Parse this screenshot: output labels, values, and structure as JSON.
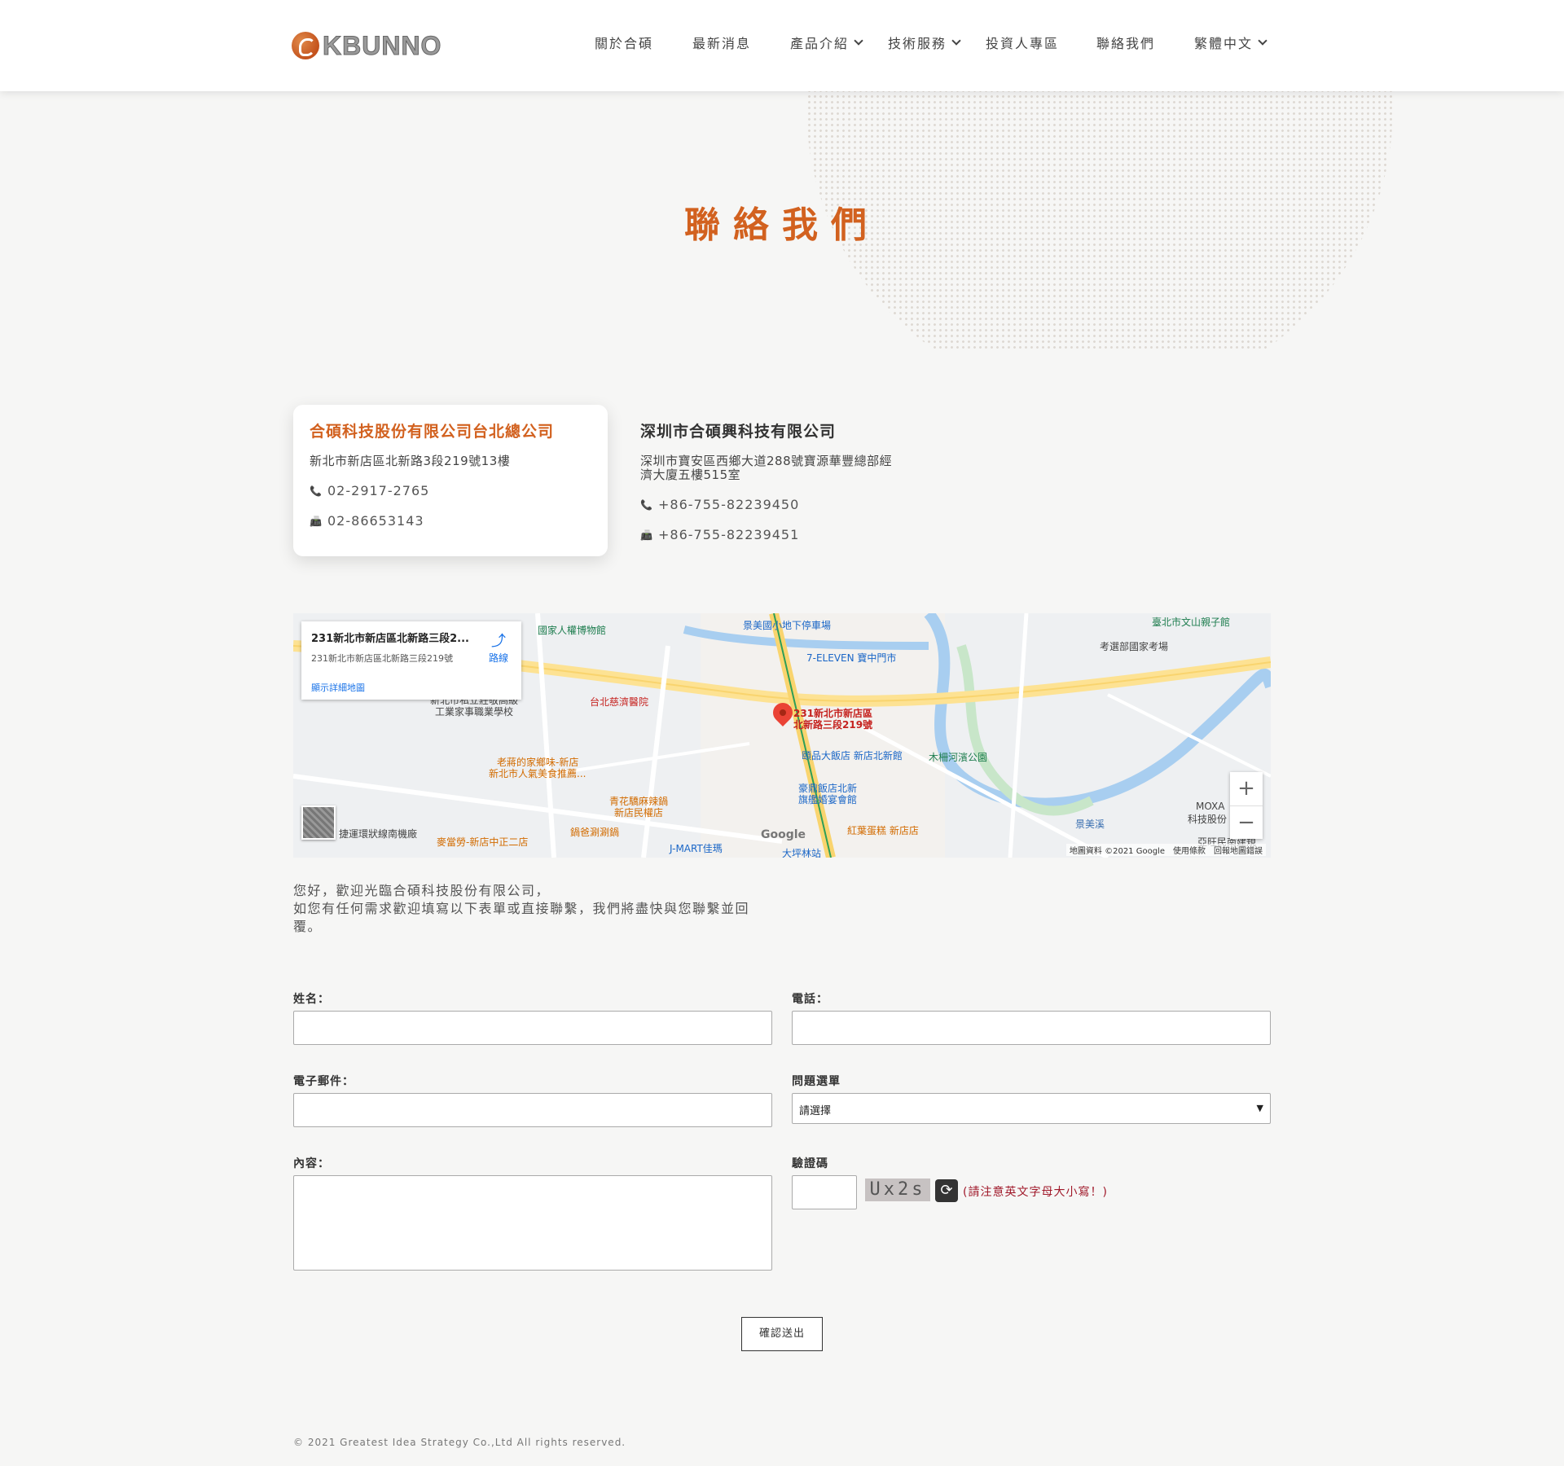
{
  "header": {
    "logo_text": "KBUNNO",
    "nav": [
      {
        "label": "關於合碩",
        "dropdown": false
      },
      {
        "label": "最新消息",
        "dropdown": false
      },
      {
        "label": "產品介紹",
        "dropdown": true
      },
      {
        "label": "技術服務",
        "dropdown": true
      },
      {
        "label": "投資人專區",
        "dropdown": false
      },
      {
        "label": "聯絡我們",
        "dropdown": false
      },
      {
        "label": "繁體中文",
        "dropdown": true
      }
    ]
  },
  "hero": {
    "title": "聯絡我們"
  },
  "offices": [
    {
      "name": "合碩科技股份有限公司台北總公司",
      "address": "新北市新店區北新路3段219號13樓",
      "phone": "02-2917-2765",
      "fax": "02-86653143"
    },
    {
      "name": "深圳市合碩興科技有限公司",
      "address_line1": "深圳市寶安區西鄉大道288號寶源華豐總部經",
      "address_line2": "濟大廈五樓515室",
      "phone": "+86-755-82239450",
      "fax": "+86-755-82239451"
    }
  ],
  "map": {
    "info_title": "231新北市新店區北新路三段2...",
    "info_address": "231新北市新店區北新路三段219號",
    "route_label": "路線",
    "detail_link": "顯示詳細地圖",
    "pin_label_1": "231新北市新店區",
    "pin_label_2": "北新路三段219號",
    "google_logo": "Google",
    "credit": "地圖資料 ©2021 Google　使用條款　回報地圖錯誤",
    "zoom_in": "+",
    "zoom_out": "−",
    "labels": [
      {
        "text": "國家人權博物館",
        "color": "#1e7d4f"
      },
      {
        "text": "景美國小地下停車場",
        "color": "#1a66c7"
      },
      {
        "text": "臺北市文山親子館",
        "color": "#1e7d4f"
      },
      {
        "text": "考選部國家考場",
        "color": "#444"
      },
      {
        "text": "7-ELEVEN 寶中門市",
        "color": "#1a66c7"
      },
      {
        "text": "台北慈濟醫院",
        "color": "#c5221f"
      },
      {
        "text": "新北市私立莊敬高級",
        "color": "#444"
      },
      {
        "text": "工業家事職業學校",
        "color": "#444"
      },
      {
        "text": "頤品大飯店 新店北新館",
        "color": "#1a66c7"
      },
      {
        "text": "木柵河濱公園",
        "color": "#1e7d4f"
      },
      {
        "text": "老蔣的家鄉味-新店",
        "color": "#d26b00"
      },
      {
        "text": "新北市人氣美食推薦...",
        "color": "#d26b00"
      },
      {
        "text": "豪鼎飯店北新",
        "color": "#1a66c7"
      },
      {
        "text": "旗艦婚宴會館",
        "color": "#1a66c7"
      },
      {
        "text": "青花驕麻辣鍋",
        "color": "#d26b00"
      },
      {
        "text": "新店民權店",
        "color": "#d26b00"
      },
      {
        "text": "鍋爸涮涮鍋",
        "color": "#d26b00"
      },
      {
        "text": "紅葉蛋糕 新店店",
        "color": "#d26b00"
      },
      {
        "text": "麥當勞-新店中正二店",
        "color": "#d26b00"
      },
      {
        "text": "J-MART佳瑪",
        "color": "#1a66c7"
      },
      {
        "text": "大坪林站",
        "color": "#1a66c7"
      },
      {
        "text": "捷運環狀線南機廠",
        "color": "#444"
      },
      {
        "text": "MOXA",
        "color": "#444"
      },
      {
        "text": "科技股份",
        "color": "#444"
      },
      {
        "text": "景美溪",
        "color": "#3a6fb0"
      },
      {
        "text": "亞旺民南建規",
        "color": "#444"
      }
    ]
  },
  "intro": {
    "line1": "您好，歡迎光臨合碩科技股份有限公司，",
    "line2": "如您有任何需求歡迎填寫以下表單或直接聯繫，我們將盡快與您聯繫並回",
    "line3": "覆。"
  },
  "form": {
    "name_label": "姓名：",
    "phone_label": "電話：",
    "email_label": "電子郵件：",
    "topic_label": "問題選單",
    "topic_selected": "請選擇",
    "content_label": "內容：",
    "captcha_label": "驗證碼",
    "captcha_text": "Ux2s",
    "captcha_note": "(請注意英文字母大小寫！)",
    "submit_label": "確認送出"
  },
  "footer": {
    "copyright": "© 2021 Greatest Idea Strategy Co.,Ltd All rights reserved."
  },
  "colors": {
    "accent": "#d2611f",
    "background": "#f6f6f5",
    "note_red": "#a0192a"
  }
}
